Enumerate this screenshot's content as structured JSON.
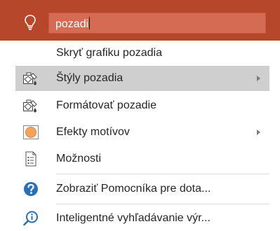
{
  "search": {
    "query": "pozadi",
    "bar_color": "#b7472a",
    "icon": "lightbulb-icon"
  },
  "menu": {
    "items": [
      {
        "label": "Skryť grafiku pozadia",
        "icon": "none",
        "has_submenu": false,
        "highlighted": false
      },
      {
        "label": "Štýly pozadia",
        "icon": "background-styles-icon",
        "has_submenu": true,
        "highlighted": true
      },
      {
        "label": "Formátovať pozadie",
        "icon": "format-background-icon",
        "has_submenu": false,
        "highlighted": false
      },
      {
        "label": "Efekty motívov",
        "icon": "theme-effects-icon",
        "has_submenu": true,
        "highlighted": false
      },
      {
        "label": "Možnosti",
        "icon": "options-document-icon",
        "has_submenu": false,
        "highlighted": false
      },
      {
        "label": "Zobraziť Pomocníka pre dota...",
        "icon": "help-icon",
        "has_submenu": false,
        "highlighted": false
      },
      {
        "label": "Inteligentné vyhľadávanie výr...",
        "icon": "smart-lookup-icon",
        "has_submenu": false,
        "highlighted": false
      }
    ]
  },
  "colors": {
    "highlight": "#cfcfcf",
    "help_blue": "#2b6fb5",
    "effects_orange": "#f5a35c"
  }
}
